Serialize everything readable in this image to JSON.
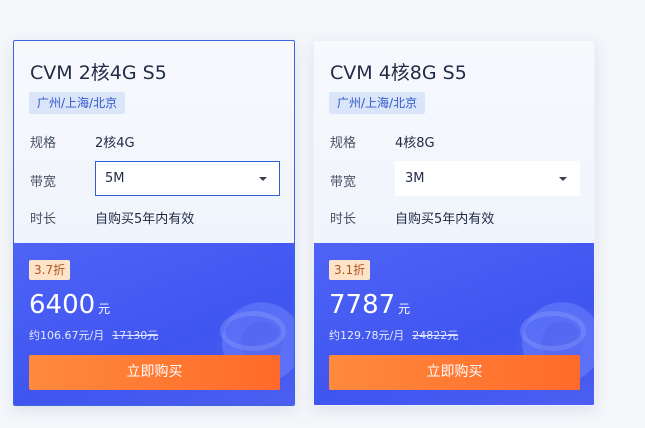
{
  "labels": {
    "spec": "规格",
    "bandwidth": "带宽",
    "duration": "时长",
    "buy": "立即购买"
  },
  "currency_unit": "元",
  "products": [
    {
      "title": "CVM 2核4G S5",
      "region": "广州/上海/北京",
      "spec": "2核4G",
      "bandwidth": "5M",
      "duration": "自购买5年内有效",
      "discount": "3.7折",
      "price": "6400",
      "monthly": "约106.67元/月",
      "original": "17130元"
    },
    {
      "title": "CVM 4核8G S5",
      "region": "广州/上海/北京",
      "spec": "4核8G",
      "bandwidth": "3M",
      "duration": "自购买5年内有效",
      "discount": "3.1折",
      "price": "7787",
      "monthly": "约129.78元/月",
      "original": "24822元"
    }
  ],
  "colors": {
    "accent": "#3d66e0",
    "buy_button": "#ff7a32",
    "price_panel": "#4a5ef3"
  }
}
